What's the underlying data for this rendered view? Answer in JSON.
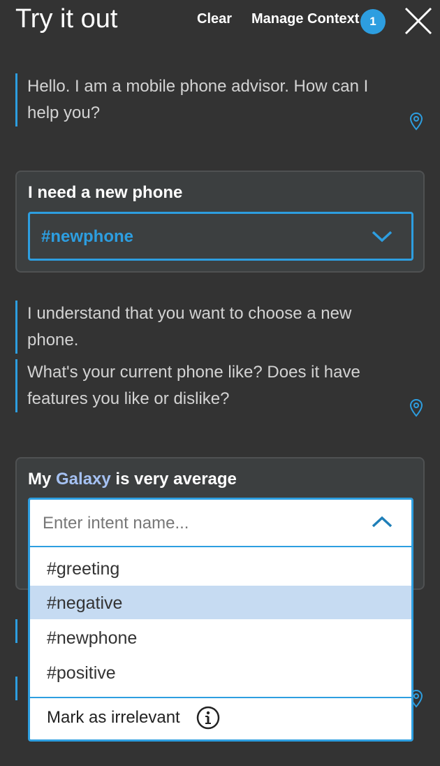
{
  "header": {
    "title": "Try it out",
    "clear_label": "Clear",
    "manage_context_label": "Manage Context",
    "context_count": "1"
  },
  "conversation": {
    "bot_message_1": "Hello. I am a mobile phone advisor. How can I help you?",
    "user_message_1": "I need a new phone",
    "user_message_1_intent": "#newphone",
    "bot_message_2": "I understand that you want to choose a new phone.",
    "bot_message_3": "What's your current phone like? Does it have features you like or dislike?",
    "user_message_2_prefix": "My ",
    "user_message_2_entity": "Galaxy",
    "user_message_2_suffix": " is very average"
  },
  "intent_dropdown": {
    "placeholder": "Enter intent name...",
    "options": [
      "#greeting",
      "#negative",
      "#newphone",
      "#positive"
    ],
    "highlighted": "#negative",
    "mark_irrelevant_label": "Mark as irrelevant"
  },
  "icons": {
    "close": "close-icon",
    "location": "location-pin-icon",
    "chevron_down": "chevron-down-icon",
    "chevron_up": "chevron-up-icon",
    "info": "info-icon"
  },
  "colors": {
    "background": "#333333",
    "accent": "#2d9ee0",
    "entity": "#a5c1f2",
    "highlight": "#c6dbf2"
  }
}
